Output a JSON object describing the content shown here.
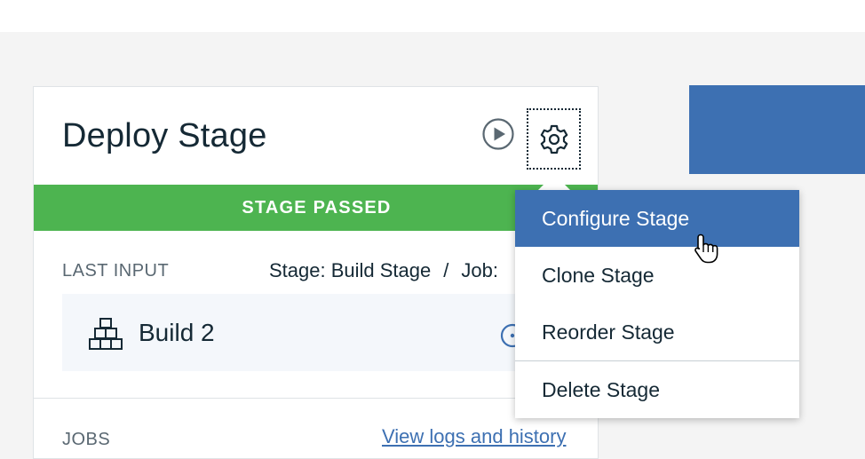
{
  "colors": {
    "accent": "#3d70b2",
    "success": "#4db450",
    "text": "#152935",
    "muted": "#5a6872"
  },
  "stage": {
    "title": "Deploy Stage",
    "status": "STAGE PASSED",
    "last_input_label": "LAST INPUT",
    "input_stage": "Stage: Build Stage",
    "input_separator": "/",
    "input_job": "Job:",
    "build_label": "Build 2",
    "jobs_label": "JOBS",
    "view_logs": "View logs and history"
  },
  "icons": {
    "play": "play-circle-icon",
    "settings": "gear-icon",
    "build": "stacked-boxes-icon",
    "history": "history-icon",
    "cursor": "hand-pointer-icon"
  },
  "menu": {
    "items": [
      {
        "label": "Configure Stage",
        "active": true
      },
      {
        "label": "Clone Stage",
        "active": false
      },
      {
        "label": "Reorder Stage",
        "active": false
      },
      {
        "label": "Delete Stage",
        "active": false
      }
    ]
  }
}
